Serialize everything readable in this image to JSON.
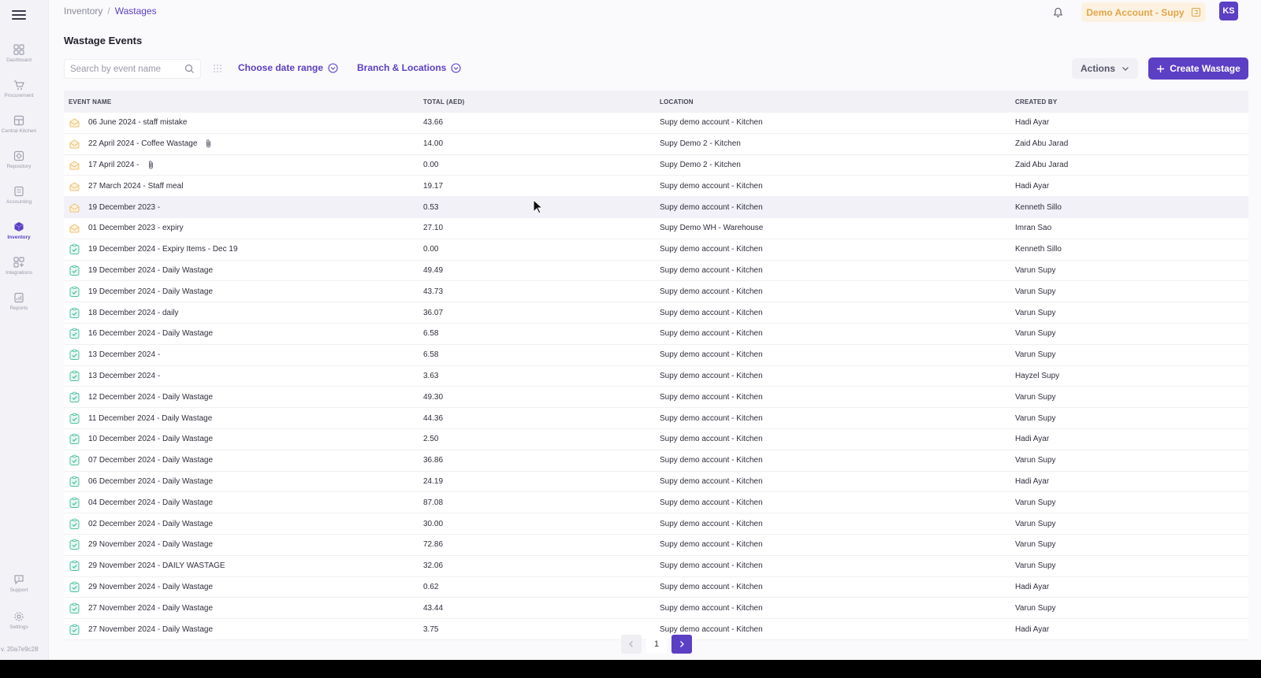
{
  "breadcrumb": {
    "root": "Inventory",
    "separator": "/",
    "current": "Wastages"
  },
  "header": {
    "account": "Demo Account - Supy",
    "avatar": "KS"
  },
  "sidebar": {
    "items": [
      {
        "label": "Dashboard",
        "icon": "dashboard-icon"
      },
      {
        "label": "Procurement",
        "icon": "cart-icon"
      },
      {
        "label": "Central Kitchen",
        "icon": "kitchen-icon"
      },
      {
        "label": "Repository",
        "icon": "repository-icon"
      },
      {
        "label": "Accounting",
        "icon": "accounting-icon"
      },
      {
        "label": "Inventory",
        "icon": "inventory-icon",
        "active": true
      },
      {
        "label": "Integrations",
        "icon": "integrations-icon"
      },
      {
        "label": "Reports",
        "icon": "reports-icon"
      }
    ],
    "bottom": [
      {
        "label": "Support",
        "icon": "support-icon"
      },
      {
        "label": "Settings",
        "icon": "gear-icon"
      }
    ],
    "version": "v. 20a7e9c28"
  },
  "page": {
    "title": "Wastage Events"
  },
  "toolbar": {
    "search_placeholder": "Search by event name",
    "date_range": "Choose date range",
    "branch": "Branch & Locations",
    "actions": "Actions",
    "create": "Create Wastage"
  },
  "table": {
    "columns": [
      "EVENT NAME",
      "TOTAL (AED)",
      "LOCATION",
      "CREATED BY"
    ],
    "rows": [
      {
        "name": "06 June 2024 - staff mistake",
        "total": "43.66",
        "location": "Supy demo account - Kitchen",
        "created_by": "Hadi Ayar",
        "status": "draft",
        "attachment": false
      },
      {
        "name": "22 April 2024 - Coffee Wastage",
        "total": "14.00",
        "location": "Supy Demo 2 - Kitchen",
        "created_by": "Zaid Abu Jarad",
        "status": "draft",
        "attachment": true
      },
      {
        "name": "17 April 2024 -",
        "total": "0.00",
        "location": "Supy Demo 2 - Kitchen",
        "created_by": "Zaid Abu Jarad",
        "status": "draft",
        "attachment": true
      },
      {
        "name": "27 March 2024 - Staff meal",
        "total": "19.17",
        "location": "Supy demo account - Kitchen",
        "created_by": "Hadi Ayar",
        "status": "draft",
        "attachment": false
      },
      {
        "name": "19 December 2023 -",
        "total": "0.53",
        "location": "Supy demo account - Kitchen",
        "created_by": "Kenneth Sillo",
        "status": "draft",
        "attachment": false
      },
      {
        "name": "01 December 2023 - expiry",
        "total": "27.10",
        "location": "Supy Demo WH - Warehouse",
        "created_by": "Imran Sao",
        "status": "draft",
        "attachment": false
      },
      {
        "name": "19 December 2024 - Expiry Items - Dec 19",
        "total": "0.00",
        "location": "Supy demo account - Kitchen",
        "created_by": "Kenneth Sillo",
        "status": "submitted",
        "attachment": false
      },
      {
        "name": "19 December 2024 - Daily Wastage",
        "total": "49.49",
        "location": "Supy demo account - Kitchen",
        "created_by": "Varun Supy",
        "status": "submitted",
        "attachment": false
      },
      {
        "name": "19 December 2024 - Daily Wastage",
        "total": "43.73",
        "location": "Supy demo account - Kitchen",
        "created_by": "Varun Supy",
        "status": "submitted",
        "attachment": false
      },
      {
        "name": "18 December 2024 - daily",
        "total": "36.07",
        "location": "Supy demo account - Kitchen",
        "created_by": "Varun Supy",
        "status": "submitted",
        "attachment": false
      },
      {
        "name": "16 December 2024 - Daily Wastage",
        "total": "6.58",
        "location": "Supy demo account - Kitchen",
        "created_by": "Varun Supy",
        "status": "submitted",
        "attachment": false
      },
      {
        "name": "13 December 2024 -",
        "total": "6.58",
        "location": "Supy demo account - Kitchen",
        "created_by": "Varun Supy",
        "status": "submitted",
        "attachment": false
      },
      {
        "name": "13 December 2024 -",
        "total": "3.63",
        "location": "Supy demo account - Kitchen",
        "created_by": "Hayzel Supy",
        "status": "submitted",
        "attachment": false
      },
      {
        "name": "12 December 2024 - Daily Wastage",
        "total": "49.30",
        "location": "Supy demo account - Kitchen",
        "created_by": "Varun Supy",
        "status": "submitted",
        "attachment": false
      },
      {
        "name": "11 December 2024 - Daily Wastage",
        "total": "44.36",
        "location": "Supy demo account - Kitchen",
        "created_by": "Varun Supy",
        "status": "submitted",
        "attachment": false
      },
      {
        "name": "10 December 2024 - Daily Wastage",
        "total": "2.50",
        "location": "Supy demo account - Kitchen",
        "created_by": "Hadi Ayar",
        "status": "submitted",
        "attachment": false
      },
      {
        "name": "07 December 2024 - Daily Wastage",
        "total": "36.86",
        "location": "Supy demo account - Kitchen",
        "created_by": "Varun Supy",
        "status": "submitted",
        "attachment": false
      },
      {
        "name": "06 December 2024 - Daily Wastage",
        "total": "24.19",
        "location": "Supy demo account - Kitchen",
        "created_by": "Hadi Ayar",
        "status": "submitted",
        "attachment": false
      },
      {
        "name": "04 December 2024 - Daily Wastage",
        "total": "87.08",
        "location": "Supy demo account - Kitchen",
        "created_by": "Varun Supy",
        "status": "submitted",
        "attachment": false
      },
      {
        "name": "02 December 2024 - Daily Wastage",
        "total": "30.00",
        "location": "Supy demo account - Kitchen",
        "created_by": "Varun Supy",
        "status": "submitted",
        "attachment": false
      },
      {
        "name": "29 November 2024 - Daily Wastage",
        "total": "72.86",
        "location": "Supy demo account - Kitchen",
        "created_by": "Varun Supy",
        "status": "submitted",
        "attachment": false
      },
      {
        "name": "29 November 2024 - DAILY WASTAGE",
        "total": "32.06",
        "location": "Supy demo account - Kitchen",
        "created_by": "Varun Supy",
        "status": "submitted",
        "attachment": false
      },
      {
        "name": "29 November 2024 - Daily Wastage",
        "total": "0.62",
        "location": "Supy demo account - Kitchen",
        "created_by": "Hadi Ayar",
        "status": "submitted",
        "attachment": false
      },
      {
        "name": "27 November 2024 - Daily Wastage",
        "total": "43.44",
        "location": "Supy demo account - Kitchen",
        "created_by": "Varun Supy",
        "status": "submitted",
        "attachment": false
      },
      {
        "name": "27 November 2024 - Daily Wastage",
        "total": "3.75",
        "location": "Supy demo account - Kitchen",
        "created_by": "Hadi Ayar",
        "status": "submitted",
        "attachment": false
      }
    ]
  },
  "pagination": {
    "current": "1"
  },
  "colors": {
    "accent": "#5b3fc4",
    "draft": "#f0c070",
    "submitted": "#4cc0a0",
    "account_text": "#e3a54a",
    "account_bg": "#fdf2e2"
  }
}
